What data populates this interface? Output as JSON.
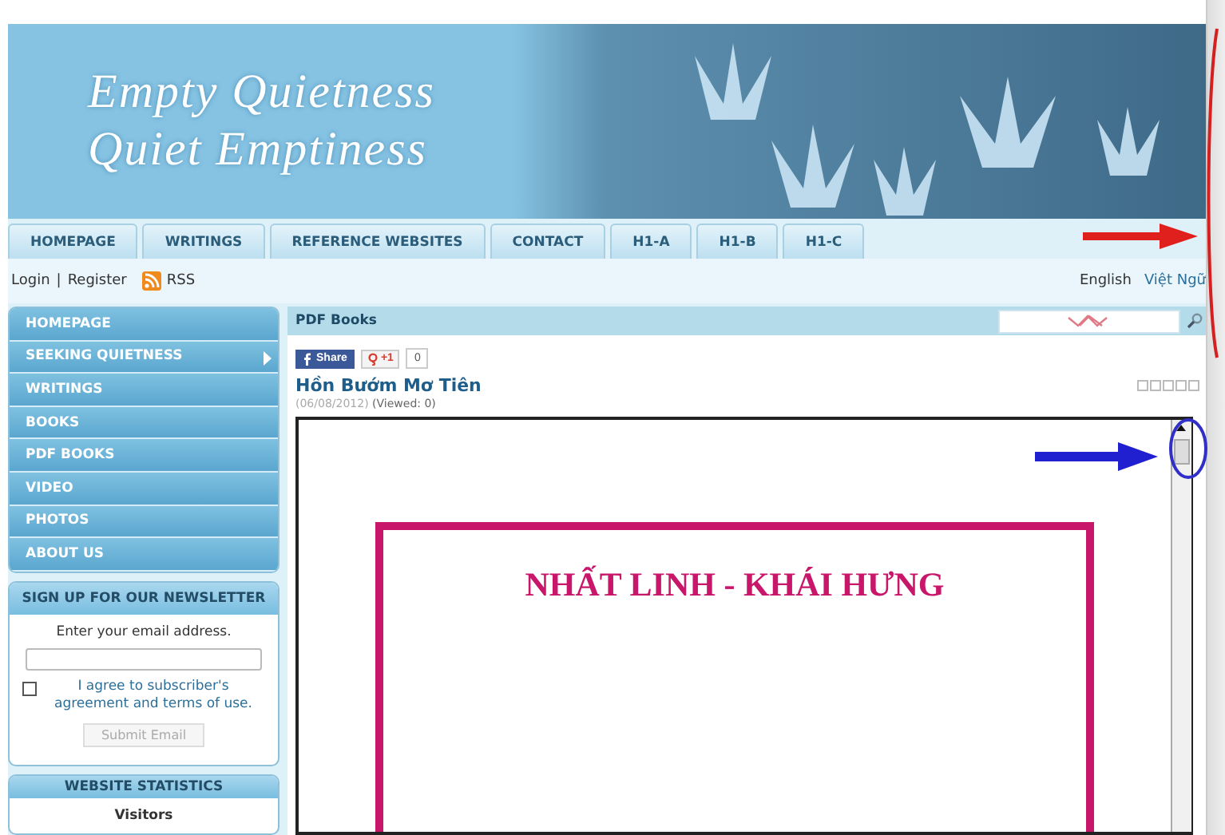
{
  "banner": {
    "title_line_1": "Empty Quietness",
    "title_line_2": "Quiet Emptiness"
  },
  "tabs": [
    {
      "label": "HOMEPAGE"
    },
    {
      "label": "WRITINGS"
    },
    {
      "label": "REFERENCE WEBSITES"
    },
    {
      "label": "CONTACT"
    },
    {
      "label": "H1-A"
    },
    {
      "label": "H1-B"
    },
    {
      "label": "H1-C"
    }
  ],
  "user_bar": {
    "login": "Login",
    "separator": "|",
    "register": "Register",
    "rss": "RSS",
    "languages": [
      "English",
      "Việt Ngữ"
    ]
  },
  "sidebar": {
    "items": [
      {
        "label": "HOMEPAGE",
        "kind": "link"
      },
      {
        "label": "SEEKING QUIETNESS",
        "kind": "submenu"
      },
      {
        "label": "WRITINGS",
        "kind": "link"
      },
      {
        "label": "BOOKS",
        "kind": "link"
      },
      {
        "label": "PDF BOOKS",
        "kind": "link"
      },
      {
        "label": "VIDEO",
        "kind": "link"
      },
      {
        "label": "PHOTOS",
        "kind": "link"
      },
      {
        "label": "ABOUT US",
        "kind": "link"
      }
    ]
  },
  "newsletter": {
    "title": "SIGN UP FOR OUR NEWSLETTER",
    "prompt": "Enter your email address.",
    "agree_checked": false,
    "agree_label": "I agree to subscriber's agreement and terms of use.",
    "button": "Submit Email"
  },
  "statistics": {
    "title": "WEBSITE STATISTICS",
    "heading": "Visitors"
  },
  "main": {
    "section_title": "PDF Books",
    "share": "Share",
    "plus_one": "+1",
    "plus_count": "0",
    "article_title": "Hồn Bướm Mơ Tiên",
    "date": "(06/08/2012)",
    "views": "(Viewed: 0)",
    "stars": 0,
    "document_heading": "NHẤT LINH - KHÁI HƯNG"
  }
}
